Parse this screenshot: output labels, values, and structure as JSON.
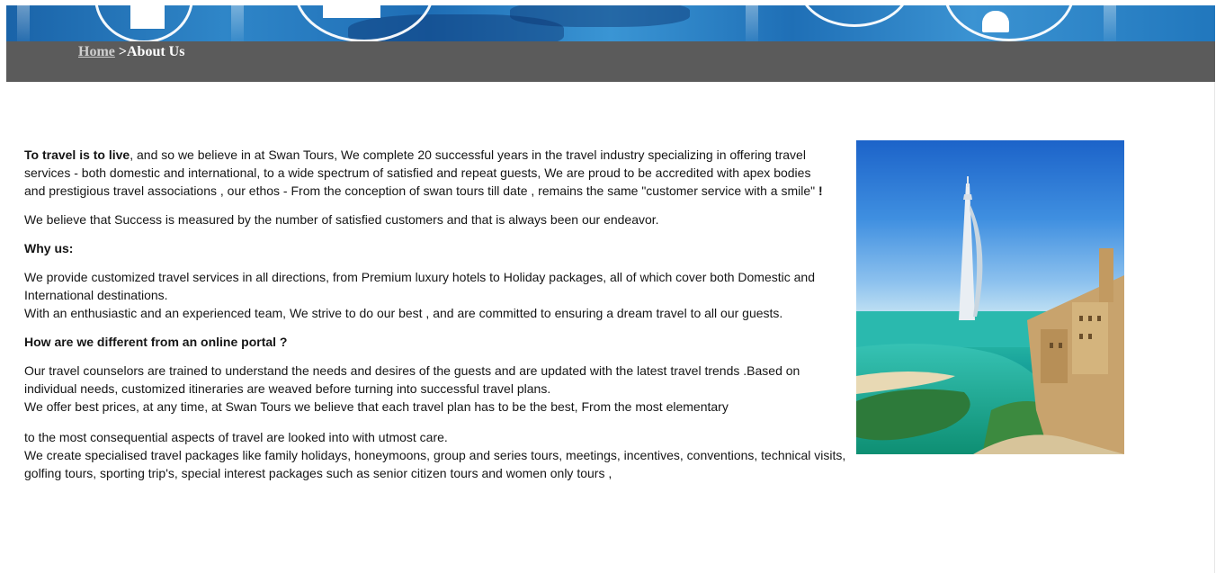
{
  "breadcrumb": {
    "home": "Home",
    "separator": " >",
    "current": "About Us"
  },
  "content": {
    "intro_bold": "To travel is to live",
    "intro_rest": ", and so we believe in at Swan Tours, We complete 20 successful years in the travel industry specializing in offering travel services - both domestic and international, to a wide spectrum of satisfied and repeat guests, We are proud to be accredited with apex bodies and prestigious travel associations , our ethos - From the conception of swan tours till date , remains the same \"customer service with a smile\" ",
    "intro_end": "!",
    "belief": "We believe that Success is measured by the number of satisfied customers and that is always been our endeavor.",
    "why_heading": "Why us:",
    "why_p1": "We provide customized travel services in all directions, from Premium luxury hotels to Holiday packages, all of which cover both Domestic and International destinations.",
    "why_p2": "With an enthusiastic and an experienced team, We strive to do our best , and are committed to ensuring a dream travel to all our guests.",
    "diff_heading": "How are we different from an online portal ?",
    "diff_p1": "Our travel counselors are trained to understand the needs and desires of the guests and are updated with the latest travel trends .Based on individual needs, customized itineraries are weaved before turning into successful travel plans.",
    "diff_p2": "We offer best prices, at any time, at Swan Tours we believe that each travel plan has to be the best, From the most elementary",
    "diff_p3": "to the most consequential aspects of travel are looked into with utmost care.",
    "diff_p4": "We create specialised travel packages like family holidays, honeymoons, group and series tours, meetings, incentives, conventions, technical visits, golfing tours, sporting trip's, special interest packages such as senior citizen tours and women only tours ,"
  },
  "photo": {
    "icon": "dubai-skyline-photo"
  },
  "colors": {
    "breadcrumb_bar": "#5b5b5b",
    "banner_blue": "#1e6db5",
    "text": "#151515"
  }
}
